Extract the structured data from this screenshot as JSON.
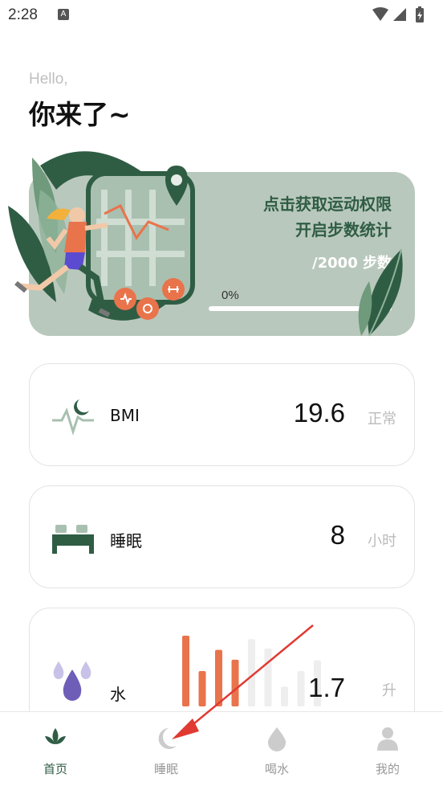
{
  "status_bar": {
    "time": "2:28",
    "notification_glyph": "A"
  },
  "greeting": {
    "hello": "Hello,",
    "title": "你来了~"
  },
  "steps_card": {
    "line1": "点击获取运动权限",
    "line2": "开启步数统计",
    "goal": "/2000 步数",
    "progress_text": "0%",
    "progress": 0
  },
  "metrics": {
    "bmi": {
      "label": "BMI",
      "value": "19.6",
      "unit": "正常"
    },
    "sleep": {
      "label": "睡眠",
      "value": "8",
      "unit": "小时"
    },
    "water": {
      "label": "水",
      "value": "1.7",
      "unit": "升",
      "bars": [
        1.0,
        0.5,
        0.8,
        0.66,
        0.95,
        0.82,
        0.28,
        0.5,
        0.65
      ]
    }
  },
  "bottom_nav": [
    {
      "label": "首页",
      "icon": "leaf-icon",
      "active": true
    },
    {
      "label": "睡眠",
      "icon": "moon-icon",
      "active": false
    },
    {
      "label": "喝水",
      "icon": "water-drop-icon",
      "active": false
    },
    {
      "label": "我的",
      "icon": "user-icon",
      "active": false
    }
  ],
  "colors": {
    "primary": "#2f5d44",
    "card_bg": "#b9c8bd",
    "accent_orange": "#e9734b",
    "water_purple": "#6f5eb8",
    "annotation_red": "#e03a32"
  }
}
